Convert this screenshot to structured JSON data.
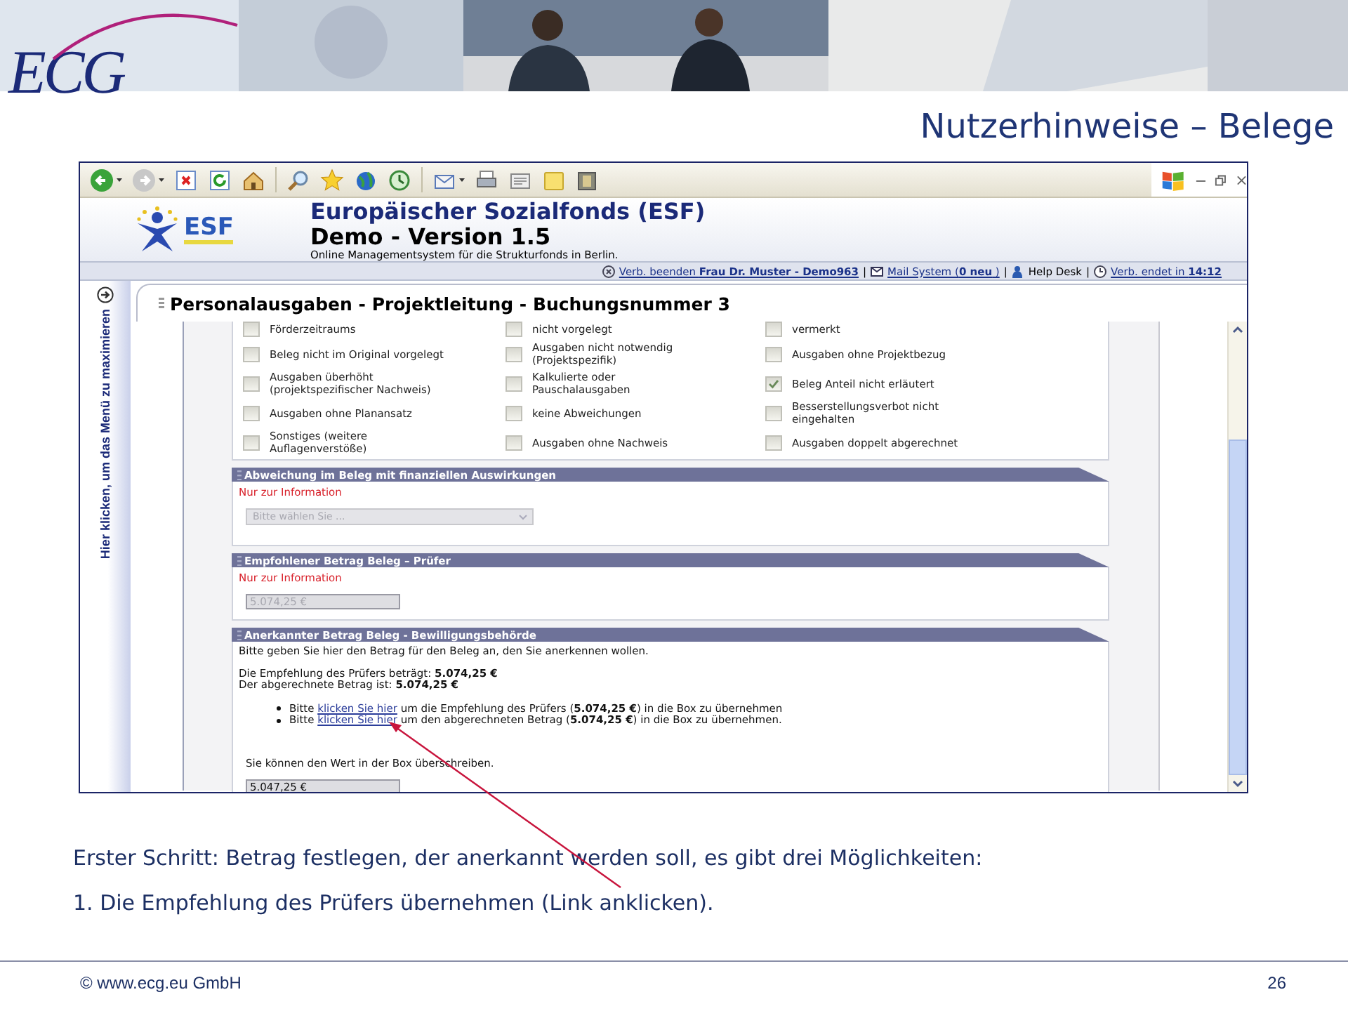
{
  "slide": {
    "logo": "ECG",
    "title": "Nutzerhinweise – Belege"
  },
  "browser": {
    "app": {
      "logo": "ESF",
      "title": "Europäischer Sozialfonds (ESF)",
      "subtitle": "Demo - Version 1.5",
      "tagline": "Online Managementsystem für die Strukturfonds in Berlin."
    },
    "session_bar": [
      {
        "kind": "link",
        "text": "Verb. beenden **Frau Dr. Muster - Demo963**"
      },
      {
        "kind": "separator",
        "text": "|"
      },
      {
        "kind": "link",
        "text": "Mail System (**0 neu** )"
      },
      {
        "kind": "separator",
        "text": "|"
      },
      {
        "kind": "text",
        "text": "Help Desk"
      },
      {
        "kind": "separator",
        "text": "|"
      },
      {
        "kind": "link",
        "text": "Verb. endet in **14:12**"
      }
    ],
    "sidebar_hint": "Hier klicken, um das Menü zu maximieren",
    "page_title": "Personalausgaben - Projektleitung - Buchungsnummer 3",
    "checklist": [
      {
        "label": "Förderzeitraums",
        "checked": false
      },
      {
        "label": "nicht vorgelegt",
        "checked": false
      },
      {
        "label": "vermerkt",
        "checked": false
      },
      {
        "label": "Beleg nicht im Original vorgelegt",
        "checked": false
      },
      {
        "label": "Ausgaben nicht notwendig\n(Projektspezifik)",
        "checked": false
      },
      {
        "label": "Ausgaben ohne Projektbezug",
        "checked": false
      },
      {
        "label": "Ausgaben überhöht\n(projektspezifischer Nachweis)",
        "checked": false
      },
      {
        "label": "Kalkulierte oder\nPauschalausgaben",
        "checked": false
      },
      {
        "label": "Beleg Anteil nicht erläutert",
        "checked": true
      },
      {
        "label": "Ausgaben ohne Planansatz",
        "checked": false
      },
      {
        "label": "keine Abweichungen",
        "checked": false
      },
      {
        "label": "Besserstellungsverbot nicht\neingehalten",
        "checked": false
      },
      {
        "label": "Sonstiges (weitere\nAuflagenverstöße)",
        "checked": false
      },
      {
        "label": "Ausgaben ohne Nachweis",
        "checked": false
      },
      {
        "label": "Ausgaben doppelt abgerechnet",
        "checked": false
      }
    ],
    "sections": [
      {
        "kind": "select",
        "title": "Abweichung im Beleg mit finanziellen Auswirkungen",
        "note": "Nur zur Information",
        "value": "Bitte wählen Sie ...",
        "disabled": true
      },
      {
        "kind": "amount",
        "title": "Empfohlener Betrag Beleg – Prüfer",
        "note": "Nur zur Information",
        "value": "5.074,25 €",
        "disabled": true
      },
      {
        "kind": "entry",
        "title": "Anerkannter Betrag Beleg - Bewilligungsbehörde",
        "intro": "Bitte geben Sie hier den Betrag für den Beleg an, den Sie anerkennen wollen.",
        "facts": [
          "Die Empfehlung des Prüfers beträgt: **5.074,25 €**",
          "Der abgerechnete Betrag ist: **5.074,25 €**"
        ],
        "options": [
          {
            "before": "Bitte",
            "link": "klicken Sie hier",
            "after": "um die Empfehlung des Prüfers (**5.074,25 €**) in die Box zu übernehmen"
          },
          {
            "before": "Bitte",
            "link": "klicken Sie hier",
            "after": "um den abgerechneten Betrag (**5.074,25 €**) in die Box zu übernehmen."
          }
        ],
        "hint": "Sie können den Wert in der Box überschreiben.",
        "value": "5.047,25 €",
        "disabled": false
      }
    ]
  },
  "notes": [
    "Erster Schritt: Betrag festlegen, der anerkannt werden soll, es gibt drei Möglichkeiten:",
    "1. Die Empfehlung des Prüfers übernehmen (Link anklicken)."
  ],
  "footer": {
    "copyright": "© www.ecg.eu GmbH",
    "page": "26"
  }
}
